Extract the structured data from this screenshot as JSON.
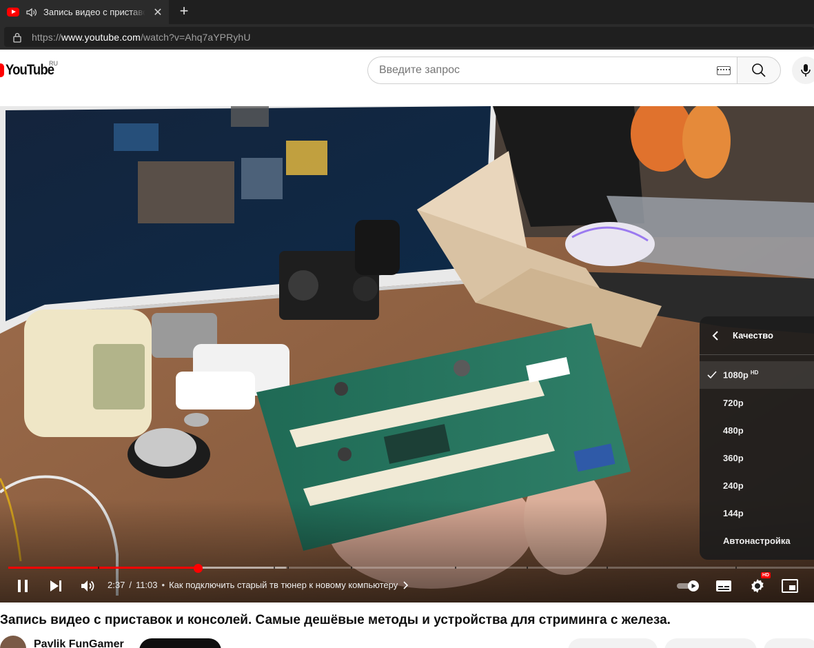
{
  "browser": {
    "tab_title": "Запись видео с приставок и консолей. Самые дешёвые методы",
    "tab_close": "✕",
    "new_tab": "+",
    "url_prefix": "https://",
    "url_host": "www.youtube.com",
    "url_path": "/watch?v=Ahq7aYPRyhU"
  },
  "header": {
    "logo_text": "YouTube",
    "region": "RU",
    "search_placeholder": "Введите запрос"
  },
  "player": {
    "progress_played_fraction": 0.236,
    "progress_loaded_fraction": 0.345,
    "time_current": "2:37",
    "time_separator": "/",
    "time_total": "11:03",
    "chapter_dot": "•",
    "chapter_title": "Как подключить старый тв тюнер к новому компьютеру",
    "settings_badge": "HD"
  },
  "quality_menu": {
    "title": "Качество",
    "options": [
      {
        "label": "1080p",
        "badge": "HD"
      },
      {
        "label": "720p"
      },
      {
        "label": "480p"
      },
      {
        "label": "360p"
      },
      {
        "label": "240p"
      },
      {
        "label": "144p"
      },
      {
        "label": "Автонастройка"
      }
    ],
    "selected": "1080p"
  },
  "video": {
    "title": "Запись видео с приставок и консолей. Самые дешёвые методы и устройства для стриминга с железа.",
    "channel_name": "Pavlik FunGamer"
  }
}
